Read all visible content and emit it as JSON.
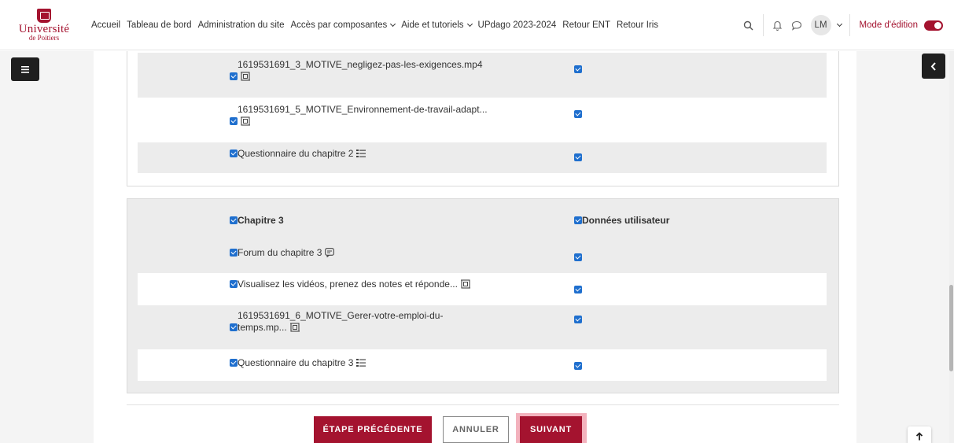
{
  "brand": {
    "name": "Université",
    "sub": "de Poitiers"
  },
  "nav": {
    "links": [
      {
        "label": "Accueil",
        "dropdown": false
      },
      {
        "label": "Tableau de bord",
        "dropdown": false
      },
      {
        "label": "Administration du site",
        "dropdown": false
      },
      {
        "label": "Accès par composantes",
        "dropdown": true
      },
      {
        "label": "Aide et tutoriels",
        "dropdown": true
      },
      {
        "label": "UPdago 2023-2024",
        "dropdown": false
      },
      {
        "label": "Retour ENT",
        "dropdown": false
      },
      {
        "label": "Retour Iris",
        "dropdown": false
      }
    ],
    "user_initials": "LM",
    "edit_mode_label": "Mode d'édition",
    "edit_mode_on": true
  },
  "section1": {
    "rows": [
      {
        "name": "1619531691_3_MOTIVE_negligez-pas-les-exigences.mp4",
        "icon": "page-icon",
        "checked": true,
        "user_data_checked": true
      },
      {
        "name": "1619531691_5_MOTIVE_Environnement-de-travail-adapt...",
        "icon": "page-icon",
        "checked": true,
        "user_data_checked": true
      },
      {
        "name": "Questionnaire du chapitre 2",
        "icon": "quiz-icon",
        "checked": true,
        "user_data_checked": true
      }
    ]
  },
  "section2": {
    "header": {
      "title": "Chapitre 3",
      "user_data_label": "Données utilisateur"
    },
    "rows": [
      {
        "name": "Forum du chapitre 3",
        "icon": "forum-icon",
        "checked": true,
        "user_data_checked": true
      },
      {
        "name": "Visualisez les vidéos, prenez des notes et réponde...",
        "icon": "page-icon",
        "checked": true,
        "user_data_checked": true
      },
      {
        "name_line1": "1619531691_6_MOTIVE_Gerer-votre-emploi-du-",
        "name_line2": "temps.mp...",
        "icon": "page-icon",
        "checked": true,
        "user_data_checked": true
      },
      {
        "name": "Questionnaire du chapitre 3",
        "icon": "quiz-icon",
        "checked": true,
        "user_data_checked": true
      }
    ]
  },
  "footer": {
    "prev_label": "ÉTAPE PRÉCÉDENTE",
    "cancel_label": "ANNULER",
    "next_label": "SUIVANT"
  },
  "colors": {
    "brand": "#a4132f",
    "checkbox": "#1f6fce",
    "row_grey": "#ececec"
  }
}
